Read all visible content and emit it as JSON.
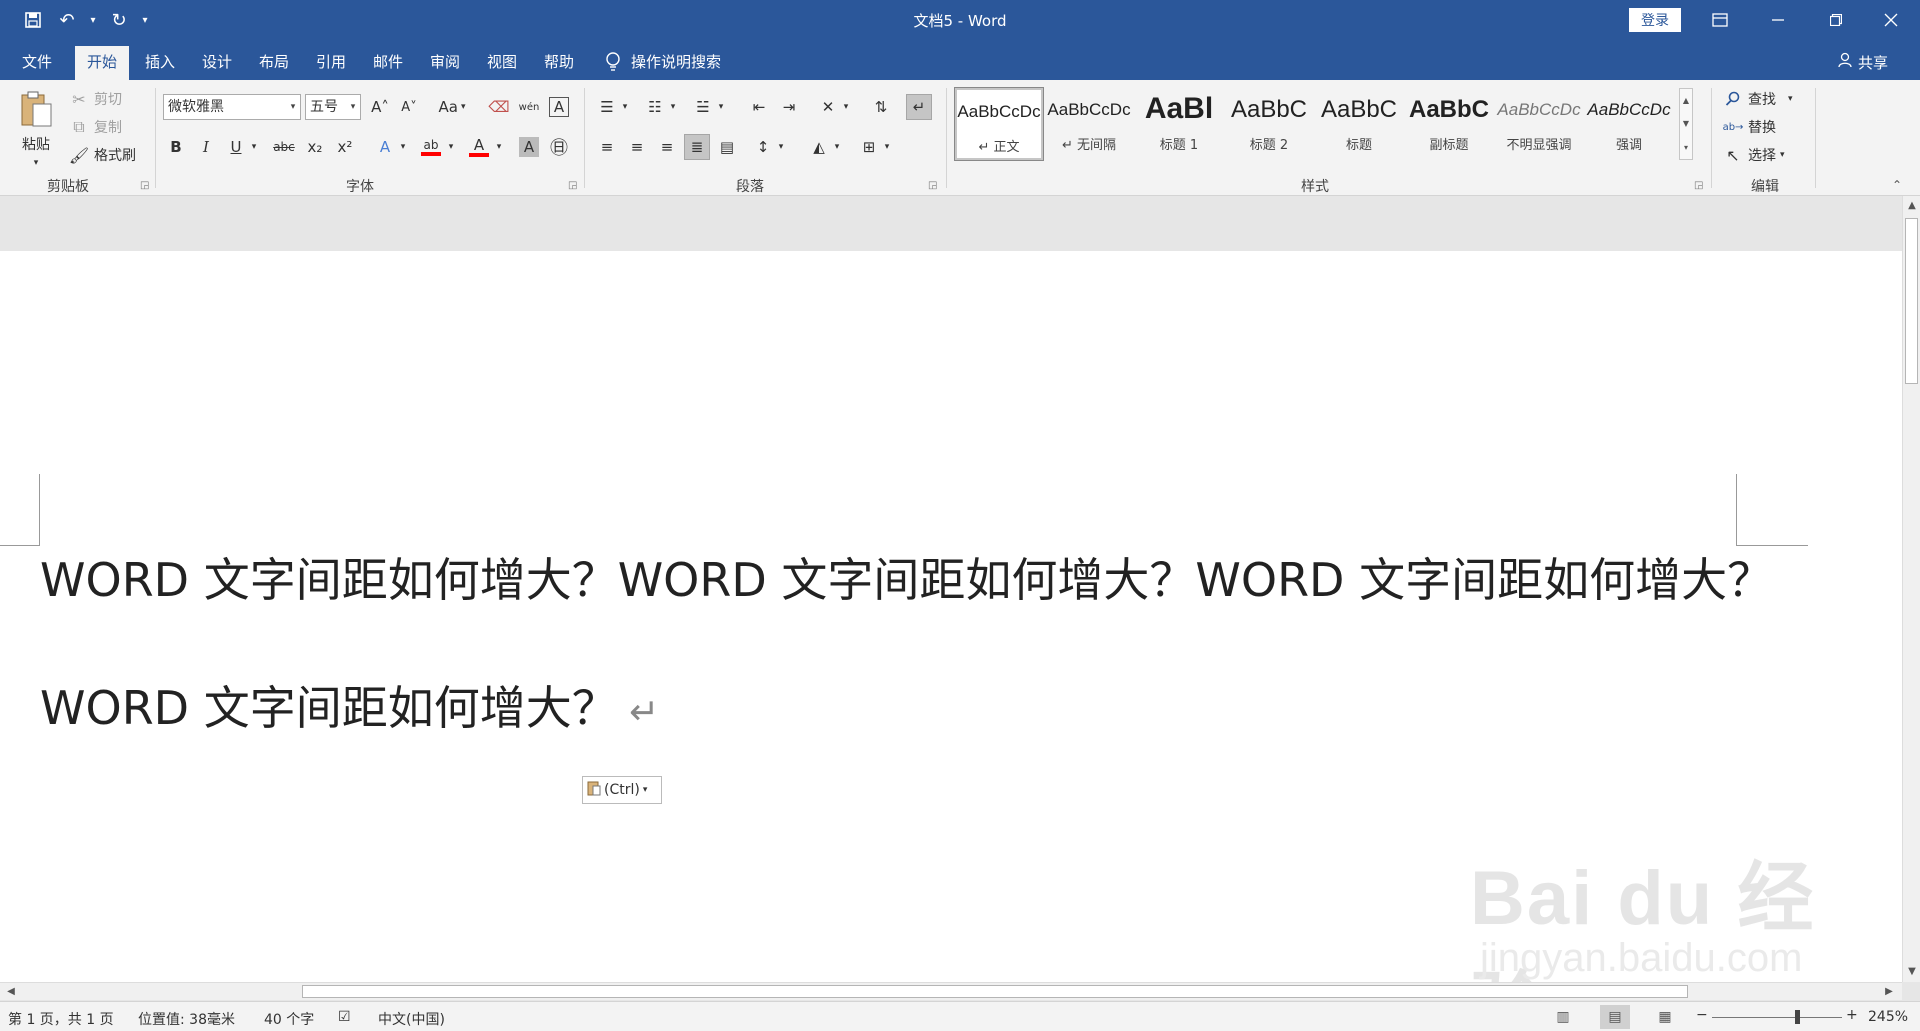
{
  "titlebar": {
    "title": "文档5  -  Word",
    "login": "登录",
    "qat_save": "💾",
    "qat_undo": "↶",
    "qat_redo": "↻",
    "qat_caret": "▾"
  },
  "tabs": [
    "文件",
    "开始",
    "插入",
    "设计",
    "布局",
    "引用",
    "邮件",
    "审阅",
    "视图",
    "帮助"
  ],
  "tellme": "操作说明搜索",
  "share": "共享",
  "clipboard": {
    "paste": "粘贴",
    "cut": "剪切",
    "copy": "复制",
    "format_painter": "格式刷",
    "label": "剪贴板"
  },
  "font": {
    "name": "微软雅黑",
    "size": "五号",
    "label": "字体",
    "bold": "B",
    "italic": "I",
    "underline": "U",
    "strike": "abc",
    "sub": "x₂",
    "sup": "x²",
    "grow": "A˄",
    "shrink": "A˅",
    "case": "Aa",
    "phonetic": "wén",
    "border_char": "A",
    "highlight": "ab",
    "color": "A",
    "shade": "A",
    "enclose": "㊐"
  },
  "paragraph": {
    "label": "段落"
  },
  "styles": {
    "label": "样式",
    "items": [
      {
        "sample": "AaBbCcDc",
        "name": "↵ 正文"
      },
      {
        "sample": "AaBbCcDc",
        "name": "↵ 无间隔"
      },
      {
        "sample": "AaBl",
        "name": "标题 1"
      },
      {
        "sample": "AaBbC",
        "name": "标题 2"
      },
      {
        "sample": "AaBbC",
        "name": "标题"
      },
      {
        "sample": "AaBbC",
        "name": "副标题"
      },
      {
        "sample": "AaBbCcDc",
        "name": "不明显强调"
      },
      {
        "sample": "AaBbCcDc",
        "name": "强调"
      }
    ]
  },
  "editing": {
    "label": "编辑",
    "find": "查找",
    "replace": "替换",
    "select": "选择"
  },
  "document": {
    "text": "WORD  文字间距如何增大？WORD  文字间距如何增大？WORD  文字间距如何增大？WORD 文字间距如何增大？",
    "paste_options": "(Ctrl)"
  },
  "watermark": {
    "logo": "Bai  du 经验",
    "url": "jingyan.baidu.com"
  },
  "statusbar": {
    "page": "第 1 页，共 1 页",
    "position": "位置值: 38毫米",
    "words": "40 个字",
    "language": "中文(中国)",
    "zoom": "245%",
    "zoom_minus": "−",
    "zoom_plus": "+"
  },
  "colors": {
    "brand": "#2b579a",
    "ribbon": "#f3f3f3",
    "highlight_bar": "#ff0000"
  }
}
